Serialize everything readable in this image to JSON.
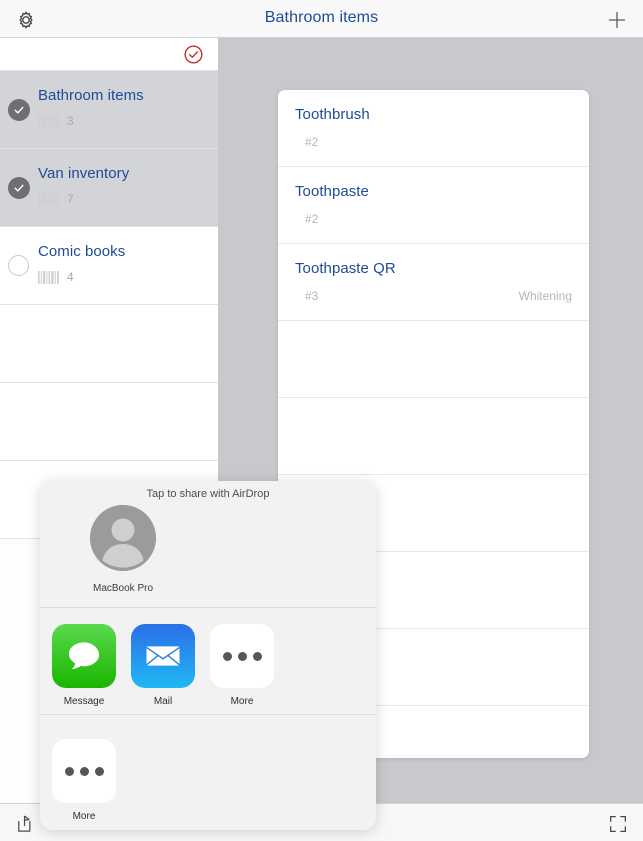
{
  "navbar": {
    "title": "Bathroom items",
    "gear_icon": "gear-icon",
    "add_icon": "plus-icon"
  },
  "sidebar": {
    "select_all_icon": "circled-check-icon",
    "items": [
      {
        "title": "Bathroom items",
        "count": "3",
        "selected": true,
        "checked": true
      },
      {
        "title": "Van inventory",
        "count": "7",
        "selected": true,
        "checked": true
      },
      {
        "title": "Comic books",
        "count": "4",
        "selected": false,
        "checked": false
      }
    ],
    "empty_rows": 3
  },
  "detail": {
    "items": [
      {
        "title": "Toothbrush",
        "sub": "#2",
        "note": ""
      },
      {
        "title": "Toothpaste",
        "sub": "#2",
        "note": ""
      },
      {
        "title": "Toothpaste QR",
        "sub": "#3",
        "note": "Whitening"
      }
    ],
    "empty_rows": 5
  },
  "share_sheet": {
    "airdrop_prompt": "Tap to share with AirDrop",
    "airdrop_targets": [
      {
        "name": "MacBook Pro",
        "avatar": "person-avatar"
      }
    ],
    "apps": [
      {
        "label": "Message",
        "icon": "message-bubble-icon",
        "style": "icon-green"
      },
      {
        "label": "Mail",
        "icon": "envelope-icon",
        "style": "icon-blue"
      },
      {
        "label": "More",
        "icon": "ellipsis-icon",
        "style": "icon-white"
      }
    ],
    "actions": [
      {
        "label": "More",
        "icon": "ellipsis-icon",
        "style": "icon-white"
      }
    ]
  },
  "bottombar": {
    "share_icon": "share-icon",
    "expand_icon": "fullscreen-icon"
  },
  "colors": {
    "accent_blue": "#1f4b99",
    "select_all_red": "#c5322b",
    "detail_backdrop": "#c8c9cd",
    "selected_row": "#d3d4d8"
  }
}
